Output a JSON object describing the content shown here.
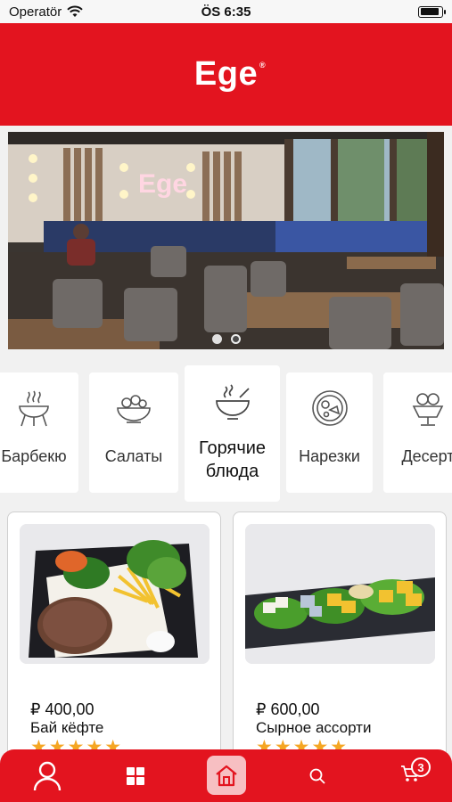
{
  "status_bar": {
    "carrier": "Operatör",
    "time": "ÖS 6:35",
    "battery_level": 0.9
  },
  "header": {
    "logo": "Ege",
    "logo_mark": "®"
  },
  "banner": {
    "sign_text": "Ege",
    "slides": 2,
    "active_slide": 1
  },
  "categories": [
    {
      "label": "Барбекю",
      "icon": "grill-icon"
    },
    {
      "label": "Салаты",
      "icon": "salad-bowl-icon"
    },
    {
      "label_line1": "Горячие",
      "label_line2": "блюда",
      "icon": "hot-bowl-icon",
      "active": true
    },
    {
      "label": "Нарезки",
      "icon": "platter-icon"
    },
    {
      "label": "Десерт",
      "icon": "ice-cream-icon"
    }
  ],
  "products": [
    {
      "price": "₽ 400,00",
      "name": "Бай кёфте",
      "rating": 5
    },
    {
      "price": "₽ 600,00",
      "name": "Сырное ассорти",
      "rating": 5
    }
  ],
  "bottom_nav": {
    "items": [
      "profile-icon",
      "grid-icon",
      "home-icon",
      "search-icon",
      "cart-icon"
    ],
    "cart_count": "3",
    "accent": "#e3141f"
  }
}
